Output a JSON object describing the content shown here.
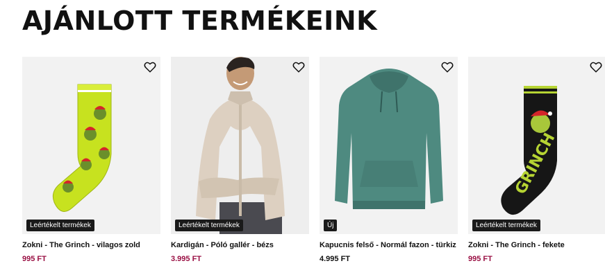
{
  "section": {
    "title": "AJÁNLOTT TERMÉKEINK"
  },
  "products": [
    {
      "name": "Zokni - The Grinch - vilagos zold",
      "price": "995 FT",
      "badge": "Leértékelt termékek",
      "price_color": "#9a1044",
      "image_icon": "green-grinch-sock-image"
    },
    {
      "name": "Kardigán - Póló gallér - bézs",
      "price": "3.995 FT",
      "badge": "Leértékelt termékek",
      "price_color": "#9a1044",
      "image_icon": "beige-cardigan-model-image"
    },
    {
      "name": "Kapucnis felső - Normál fazon - türkiz",
      "price": "4.995 FT",
      "badge": "Új",
      "price_color": "#111111",
      "image_icon": "turquoise-hoodie-image"
    },
    {
      "name": "Zokni - The Grinch - fekete",
      "price": "995 FT",
      "badge": "Leértékelt termékek",
      "price_color": "#9a1044",
      "image_icon": "black-grinch-sock-image"
    }
  ],
  "icons": {
    "favorite": "heart-outline-icon"
  }
}
